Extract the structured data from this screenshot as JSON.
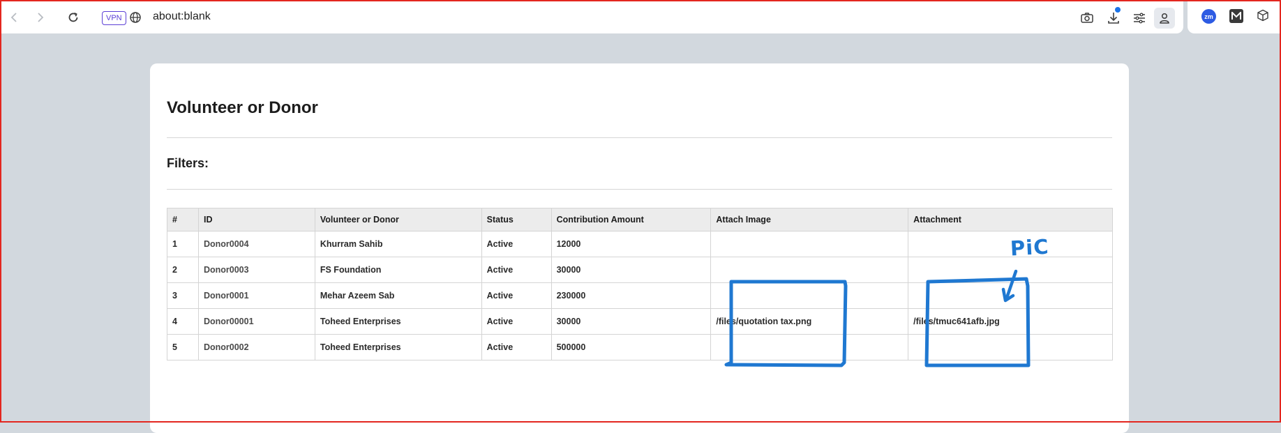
{
  "browser": {
    "vpn_label": "VPN",
    "url": "about:blank",
    "extension_zm_label": "zm"
  },
  "page": {
    "title": "Volunteer or Donor",
    "filters_label": "Filters:"
  },
  "table": {
    "headers": [
      "#",
      "ID",
      "Volunteer or Donor",
      "Status",
      "Contribution Amount",
      "Attach Image",
      "Attachment"
    ],
    "rows": [
      [
        "1",
        "Donor0004",
        "Khurram Sahib",
        "Active",
        "12000",
        "",
        ""
      ],
      [
        "2",
        "Donor0003",
        "FS Foundation",
        "Active",
        "30000",
        "",
        ""
      ],
      [
        "3",
        "Donor0001",
        "Mehar Azeem Sab",
        "Active",
        "230000",
        "",
        ""
      ],
      [
        "4",
        "Donor00001",
        "Toheed Enterprises",
        "Active",
        "30000",
        "/files/quotation tax.png",
        "/files/tmuc641afb.jpg"
      ],
      [
        "5",
        "Donor0002",
        "Toheed Enterprises",
        "Active",
        "500000",
        "",
        ""
      ]
    ]
  },
  "annotation": {
    "label": "PiC",
    "color": "#1f78d1"
  },
  "colors": {
    "page_background": "#d2d8de",
    "frame_border": "#e3261f",
    "vpn_accent": "#5b3fd6"
  }
}
